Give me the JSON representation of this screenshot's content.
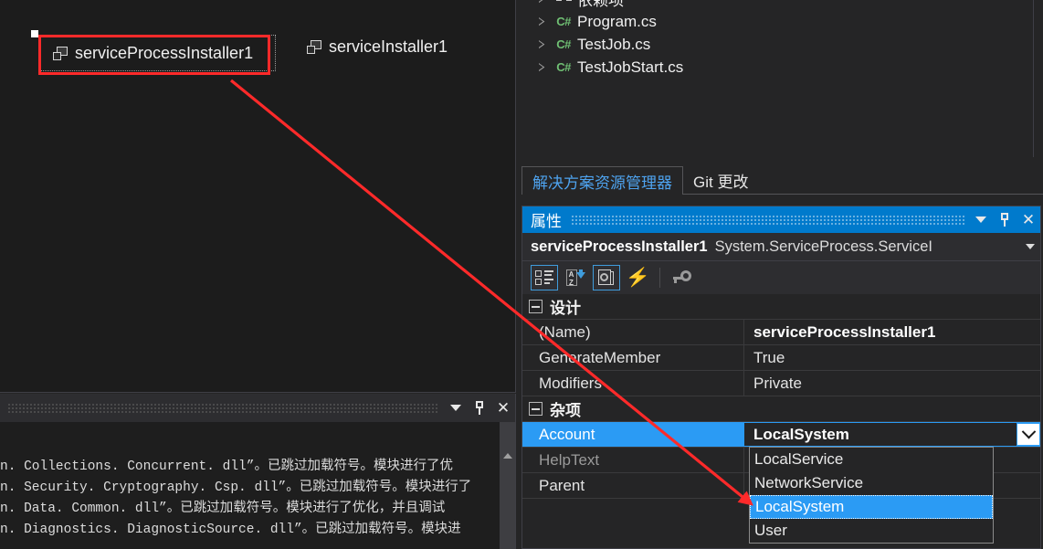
{
  "designer": {
    "components": [
      {
        "name": "serviceProcessInstaller1",
        "icon": "component-icon",
        "selected": true
      },
      {
        "name": "serviceInstaller1",
        "icon": "component-icon",
        "selected": false
      }
    ]
  },
  "solution_explorer": {
    "items": [
      {
        "label": "依赖项",
        "icon": "dependencies-icon",
        "expandable": true
      },
      {
        "label": "Program.cs",
        "icon": "csharp-file-icon",
        "expandable": true
      },
      {
        "label": "TestJob.cs",
        "icon": "csharp-file-icon",
        "expandable": true
      },
      {
        "label": "TestJobStart.cs",
        "icon": "csharp-file-icon",
        "expandable": true
      }
    ],
    "csharp_badge": "C#",
    "tabs": [
      {
        "label": "解决方案资源管理器",
        "active": true
      },
      {
        "label": "Git 更改",
        "active": false
      }
    ]
  },
  "properties": {
    "title": "属性",
    "object_name": "serviceProcessInstaller1",
    "object_type": "System.ServiceProcess.ServiceI",
    "toolbar": [
      {
        "name": "categorized-view-button",
        "selected": true
      },
      {
        "name": "alphabetical-sort-button",
        "selected": false
      },
      {
        "name": "property-pages-button",
        "selected": true
      },
      {
        "name": "events-button",
        "selected": false
      },
      {
        "name": "property-key-button",
        "selected": false
      }
    ],
    "categories": [
      {
        "label": "设计",
        "rows": [
          {
            "name": "(Name)",
            "value": "serviceProcessInstaller1",
            "bold_value": true,
            "dim_name": false,
            "selected": false
          },
          {
            "name": "GenerateMember",
            "value": "True",
            "bold_value": false,
            "dim_name": false,
            "selected": false
          },
          {
            "name": "Modifiers",
            "value": "Private",
            "bold_value": false,
            "dim_name": false,
            "selected": false
          }
        ]
      },
      {
        "label": "杂项",
        "rows": [
          {
            "name": "Account",
            "value": "LocalSystem",
            "bold_value": true,
            "dim_name": false,
            "selected": true,
            "editing": true
          },
          {
            "name": "HelpText",
            "value": "",
            "bold_value": false,
            "dim_name": true,
            "selected": false
          },
          {
            "name": "Parent",
            "value": "",
            "bold_value": false,
            "dim_name": false,
            "selected": false
          }
        ]
      }
    ],
    "account_dropdown": {
      "open": true,
      "selected": "LocalSystem",
      "options": [
        {
          "label": "LocalService",
          "highlighted": false
        },
        {
          "label": "NetworkService",
          "highlighted": false
        },
        {
          "label": "LocalSystem",
          "highlighted": true
        },
        {
          "label": "User",
          "highlighted": false
        }
      ]
    }
  },
  "output_panel": {
    "lines": [
      "n. Collections. Concurrent. dll”。已跳过加载符号。模块进行了优",
      "n. Security. Cryptography. Csp. dll”。已跳过加载符号。模块进行了",
      "n. Data. Common. dll”。已跳过加载符号。模块进行了优化，并且调试",
      "n. Diagnostics. DiagnosticSource. dll”。已跳过加载符号。模块进"
    ]
  },
  "annotation": {
    "arrow_color": "#ff2a2a",
    "highlight_box_color": "#ff2a2a"
  }
}
